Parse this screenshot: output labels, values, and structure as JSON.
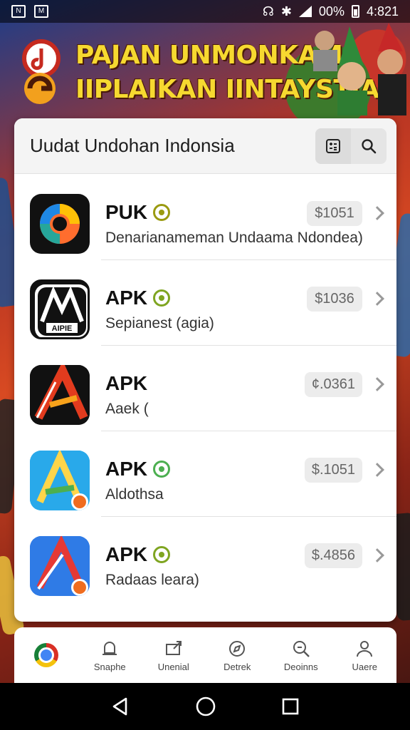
{
  "status_bar": {
    "battery": "00%",
    "time": "4:821"
  },
  "banner": {
    "title_line1": "PAJAN UNMONKAM",
    "title_line2": "IIPLAIKAN IINTAYSTIA"
  },
  "header": {
    "title": "Uudat Undohan Indonsia"
  },
  "apps": [
    {
      "name": "PUK",
      "subtitle": "Denarianameman Undaama Ndondea)",
      "price": "$1051"
    },
    {
      "name": "APK",
      "subtitle": "Sepianest (agia)",
      "price": "$1036"
    },
    {
      "name": "APK",
      "subtitle": "Aaek (",
      "price": "¢.0361"
    },
    {
      "name": "APK",
      "subtitle": "Aldothsa",
      "price": "$.1051"
    },
    {
      "name": "APK",
      "subtitle": "Radaas leara)",
      "price": "$.4856"
    }
  ],
  "icon_texts": {
    "apk_logo": "AIPIE"
  },
  "bottom_nav": [
    {
      "label": "Snaphe",
      "icon": "home-icon"
    },
    {
      "label": "Unenial",
      "icon": "share-icon"
    },
    {
      "label": "Detrek",
      "icon": "explore-icon"
    },
    {
      "label": "Deoinns",
      "icon": "search-icon"
    },
    {
      "label": "Uaere",
      "icon": "user-icon"
    }
  ],
  "colors": {
    "banner_text": "#f6d930",
    "verified": "#7fa521",
    "card_bg": "#ffffff"
  }
}
